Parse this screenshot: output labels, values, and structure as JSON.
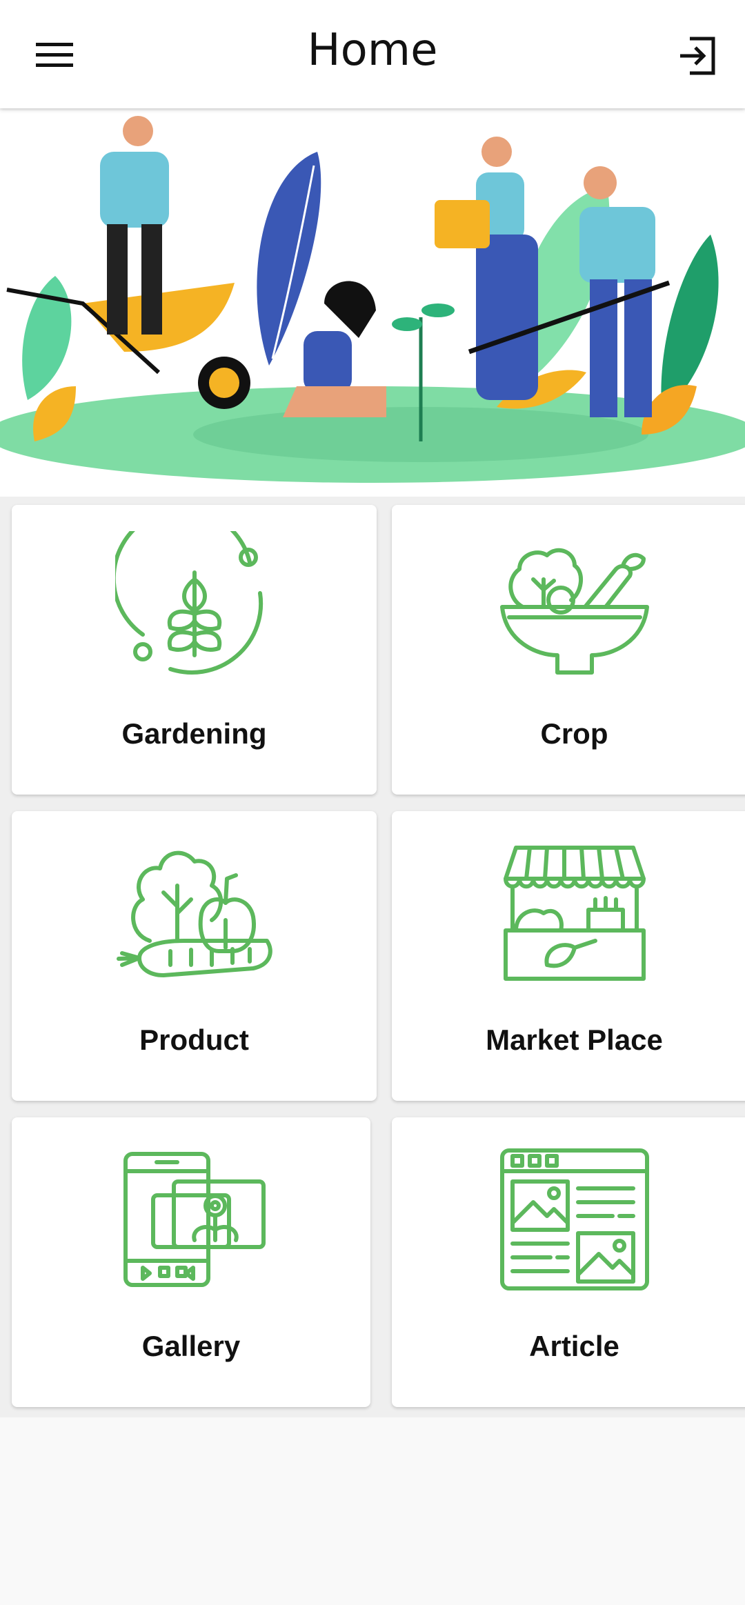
{
  "header": {
    "title": "Home",
    "menu_icon": "menu-icon",
    "logout_icon": "logout-icon"
  },
  "banner": {
    "illustration": "people-gardening-illustration"
  },
  "tiles": [
    {
      "label": "Gardening",
      "icon": "wheat-circle-icon"
    },
    {
      "label": "Crop",
      "icon": "vegetable-bowl-icon"
    },
    {
      "label": "Product",
      "icon": "vegetables-icon"
    },
    {
      "label": "Market Place",
      "icon": "market-stall-icon"
    },
    {
      "label": "Gallery",
      "icon": "gallery-phone-icon"
    },
    {
      "label": "Article",
      "icon": "article-layout-icon"
    }
  ],
  "colors": {
    "accent": "#5cb85c",
    "background": "#efefef",
    "tile": "#ffffff"
  }
}
